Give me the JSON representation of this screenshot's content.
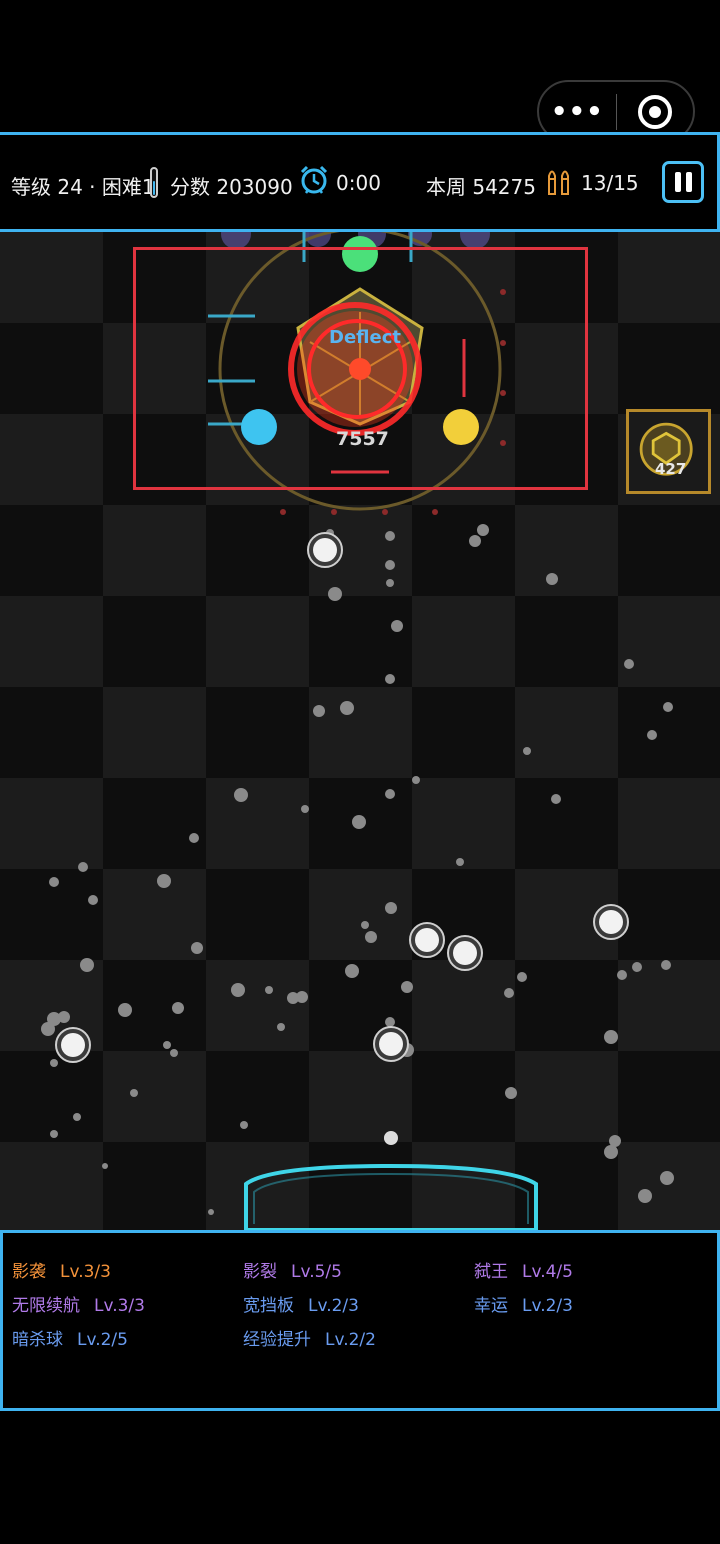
{
  "hud": {
    "level": "等级 24 · 困难1",
    "score": "分数 203090",
    "timer": "0:00",
    "week": "本周 54275",
    "ammo": "13/15"
  },
  "capsule": {
    "more_label": "•••"
  },
  "field": {
    "deflect_text": "Deflect",
    "boss_hp": "7557",
    "side_block_hp": "427",
    "colors": {
      "boss_zone": "#e0343f",
      "orb_green": "#4be07a",
      "orb_cyan": "#3ec4f0",
      "orb_yellow": "#f2cf3a",
      "paddle": "#3fd5e8"
    }
  },
  "skills": [
    {
      "name": "影袭",
      "level": "Lv.3/3",
      "color": "orange"
    },
    {
      "name": "影裂",
      "level": "Lv.5/5",
      "color": "purple"
    },
    {
      "name": "弑王",
      "level": "Lv.4/5",
      "color": "purple"
    },
    {
      "name": "无限续航",
      "level": "Lv.3/3",
      "color": "purple"
    },
    {
      "name": "宽挡板",
      "level": "Lv.2/3",
      "color": "blue"
    },
    {
      "name": "幸运",
      "level": "Lv.2/3",
      "color": "blue"
    },
    {
      "name": "暗杀球",
      "level": "Lv.2/5",
      "color": "blue"
    },
    {
      "name": "经验提升",
      "level": "Lv.2/2",
      "color": "blue"
    }
  ]
}
